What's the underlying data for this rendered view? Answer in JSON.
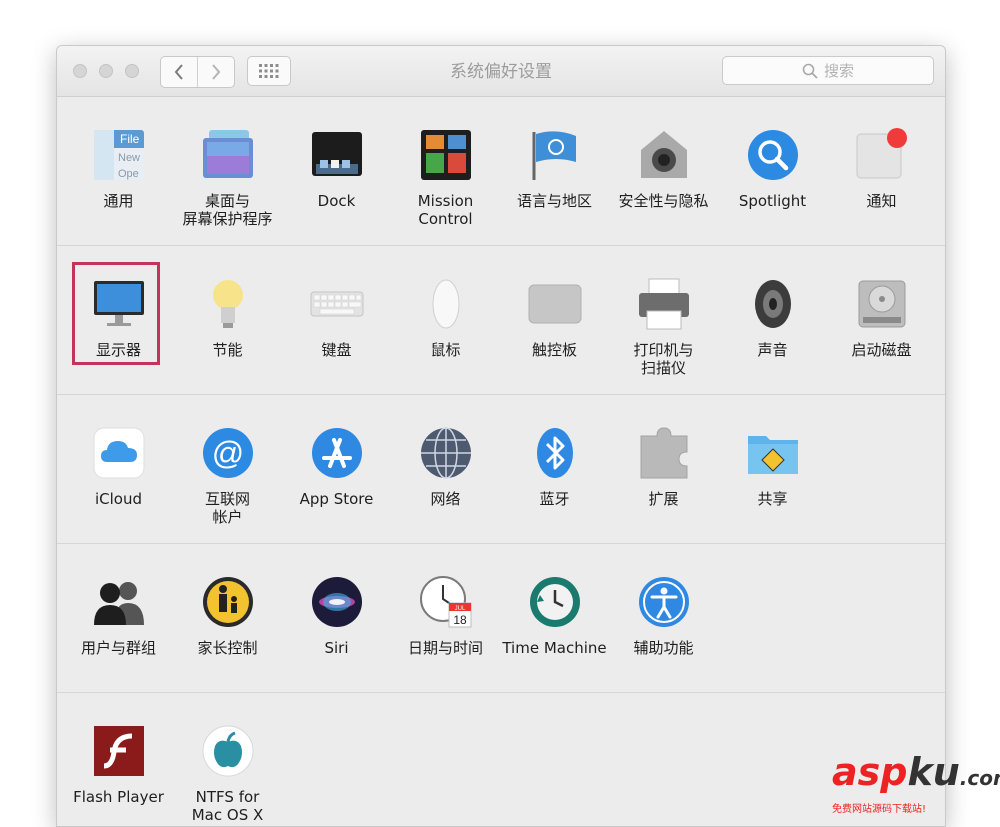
{
  "window": {
    "title": "系统偏好设置",
    "search_placeholder": "搜索"
  },
  "rows": [
    {
      "items": [
        {
          "name": "pref-general",
          "label": "通用",
          "icon": "general-icon"
        },
        {
          "name": "pref-desktop",
          "label": "桌面与\n屏幕保护程序",
          "icon": "desktop-screensaver-icon"
        },
        {
          "name": "pref-dock",
          "label": "Dock",
          "icon": "dock-icon"
        },
        {
          "name": "pref-mission-control",
          "label": "Mission\nControl",
          "icon": "mission-control-icon"
        },
        {
          "name": "pref-language",
          "label": "语言与地区",
          "icon": "language-flag-icon"
        },
        {
          "name": "pref-security",
          "label": "安全性与隐私",
          "icon": "security-house-icon"
        },
        {
          "name": "pref-spotlight",
          "label": "Spotlight",
          "icon": "spotlight-icon"
        },
        {
          "name": "pref-notifications",
          "label": "通知",
          "icon": "notifications-icon"
        }
      ]
    },
    {
      "items": [
        {
          "name": "pref-displays",
          "label": "显示器",
          "icon": "display-icon"
        },
        {
          "name": "pref-energy",
          "label": "节能",
          "icon": "lightbulb-icon"
        },
        {
          "name": "pref-keyboard",
          "label": "键盘",
          "icon": "keyboard-icon"
        },
        {
          "name": "pref-mouse",
          "label": "鼠标",
          "icon": "mouse-icon"
        },
        {
          "name": "pref-trackpad",
          "label": "触控板",
          "icon": "trackpad-icon"
        },
        {
          "name": "pref-printers",
          "label": "打印机与\n扫描仪",
          "icon": "printer-icon"
        },
        {
          "name": "pref-sound",
          "label": "声音",
          "icon": "speaker-icon"
        },
        {
          "name": "pref-startup-disk",
          "label": "启动磁盘",
          "icon": "hard-disk-icon"
        }
      ]
    },
    {
      "items": [
        {
          "name": "pref-icloud",
          "label": "iCloud",
          "icon": "icloud-icon"
        },
        {
          "name": "pref-internet-accounts",
          "label": "互联网\n帐户",
          "icon": "at-sign-icon"
        },
        {
          "name": "pref-app-store",
          "label": "App Store",
          "icon": "app-store-icon"
        },
        {
          "name": "pref-network",
          "label": "网络",
          "icon": "network-globe-icon"
        },
        {
          "name": "pref-bluetooth",
          "label": "蓝牙",
          "icon": "bluetooth-icon"
        },
        {
          "name": "pref-extensions",
          "label": "扩展",
          "icon": "puzzle-icon"
        },
        {
          "name": "pref-sharing",
          "label": "共享",
          "icon": "sharing-folder-icon"
        }
      ]
    },
    {
      "items": [
        {
          "name": "pref-users",
          "label": "用户与群组",
          "icon": "users-icon"
        },
        {
          "name": "pref-parental",
          "label": "家长控制",
          "icon": "parental-controls-icon"
        },
        {
          "name": "pref-siri",
          "label": "Siri",
          "icon": "siri-icon"
        },
        {
          "name": "pref-datetime",
          "label": "日期与时间",
          "icon": "clock-calendar-icon"
        },
        {
          "name": "pref-time-machine",
          "label": "Time Machine",
          "icon": "time-machine-icon"
        },
        {
          "name": "pref-accessibility",
          "label": "辅助功能",
          "icon": "accessibility-icon"
        }
      ]
    },
    {
      "items": [
        {
          "name": "pref-flash",
          "label": "Flash Player",
          "icon": "flash-icon"
        },
        {
          "name": "pref-ntfs",
          "label": "NTFS for\nMac OS X",
          "icon": "ntfs-apple-icon"
        }
      ]
    }
  ],
  "icon_texts": {
    "general_file": "File",
    "general_new": "New",
    "general_open": "Ope",
    "calendar_month": "JUL",
    "calendar_day": "18"
  },
  "watermark": {
    "asp": "asp",
    "ku": "ku",
    "dotcom": ".com",
    "sub": "免费网站源码下载站!"
  },
  "colors": {
    "highlight_border": "#c2345a",
    "window_bg": "#ececec"
  }
}
